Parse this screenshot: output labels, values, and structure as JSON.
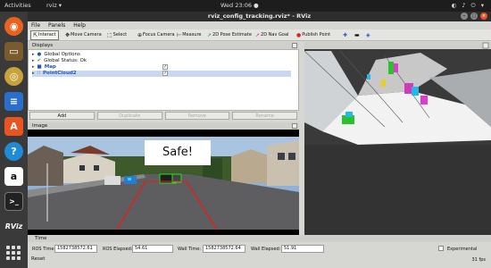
{
  "topbar": {
    "activities": "Activities",
    "app_name": "rviz ▾",
    "clock": "Wed 23:06 ●",
    "tray": "◐ ♪ ⏻ ▾"
  },
  "window": {
    "title": "rviz_config_tracking.rviz* - RViz"
  },
  "menu": {
    "file": "File",
    "panels": "Panels",
    "help": "Help"
  },
  "toolbar": {
    "interact": "Interact",
    "move_camera": "Move Camera",
    "select": "Select",
    "focus_camera": "Focus Camera",
    "measure": "Measure",
    "pose_estimate": "2D Pose Estimate",
    "nav_goal": "2D Nav Goal",
    "publish_point": "Publish Point"
  },
  "displays": {
    "header": "Displays",
    "items": [
      {
        "label": "Global Options",
        "arrow": "▸",
        "icon": "●",
        "checked": false
      },
      {
        "label": "Global Status: Ok",
        "arrow": "▸",
        "icon": "✔",
        "checked": false
      },
      {
        "label": "Map",
        "arrow": "▸",
        "icon": "■",
        "checked": true
      },
      {
        "label": "PointCloud2",
        "arrow": "▸",
        "icon": "∷",
        "checked": true
      }
    ],
    "buttons": {
      "add": "Add",
      "duplicate": "Duplicate",
      "remove": "Remove",
      "rename": "Rename"
    }
  },
  "image_panel": {
    "header": "Image",
    "overlay_text": "Safe!"
  },
  "time": {
    "header": "Time",
    "ros_time_label": "ROS Time:",
    "ros_time_value": "1582738572.61",
    "ros_elapsed_label": "ROS Elapsed:",
    "ros_elapsed_value": "54.61",
    "wall_time_label": "Wall Time:",
    "wall_time_value": "1582738572.64",
    "wall_elapsed_label": "Wall Elapsed:",
    "wall_elapsed_value": "51.91",
    "experimental": "Experimental",
    "reset": "Reset",
    "fps": "31 fps"
  },
  "colors": {
    "ubuntu_orange": "#e95420",
    "panel_bg": "#d6d6d2",
    "view_bg": "#3a3a3a"
  }
}
